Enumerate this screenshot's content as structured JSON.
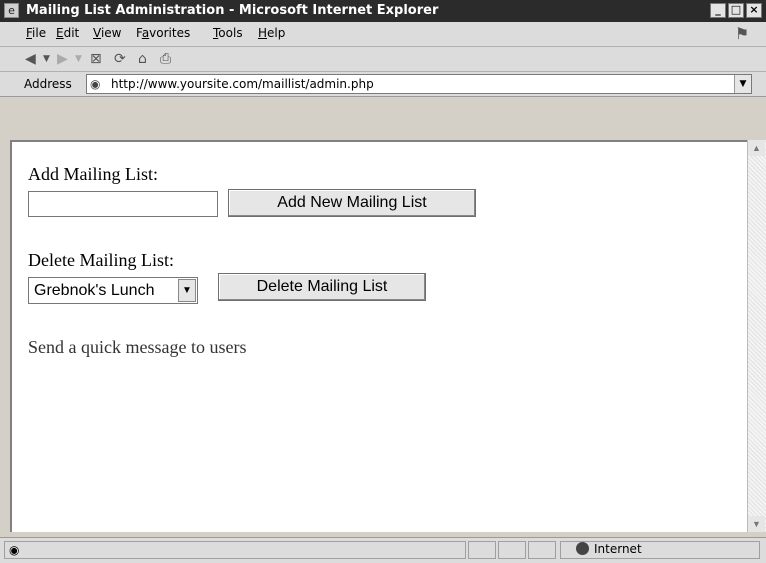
{
  "window": {
    "title": "Mailing List Administration - Microsoft Internet Explorer",
    "controls": {
      "minimize": "_",
      "maximize": "□",
      "close": "×"
    }
  },
  "menu": {
    "items": [
      "File",
      "Edit",
      "View",
      "Favorites",
      "Tools",
      "Help"
    ],
    "shortcut_letters": [
      "F",
      "E",
      "V",
      "a",
      "T",
      "H"
    ]
  },
  "toolbar": {
    "icons": [
      "back-icon",
      "back-dropdown-icon",
      "forward-icon",
      "forward-dropdown-icon",
      "stop-icon",
      "refresh-icon",
      "home-icon",
      "print-icon"
    ]
  },
  "address": {
    "label": "Address",
    "url": "http://www.yoursite.com/maillist/admin.php"
  },
  "page": {
    "add_label": "Add Mailing List:",
    "add_input_value": "",
    "add_button": "Add New Mailing List",
    "delete_label": "Delete Mailing List:",
    "delete_selected": "Grebnok's Lunch",
    "delete_button": "Delete Mailing List",
    "quick_message": "Send a quick message to users"
  },
  "status": {
    "zone": "Internet"
  }
}
